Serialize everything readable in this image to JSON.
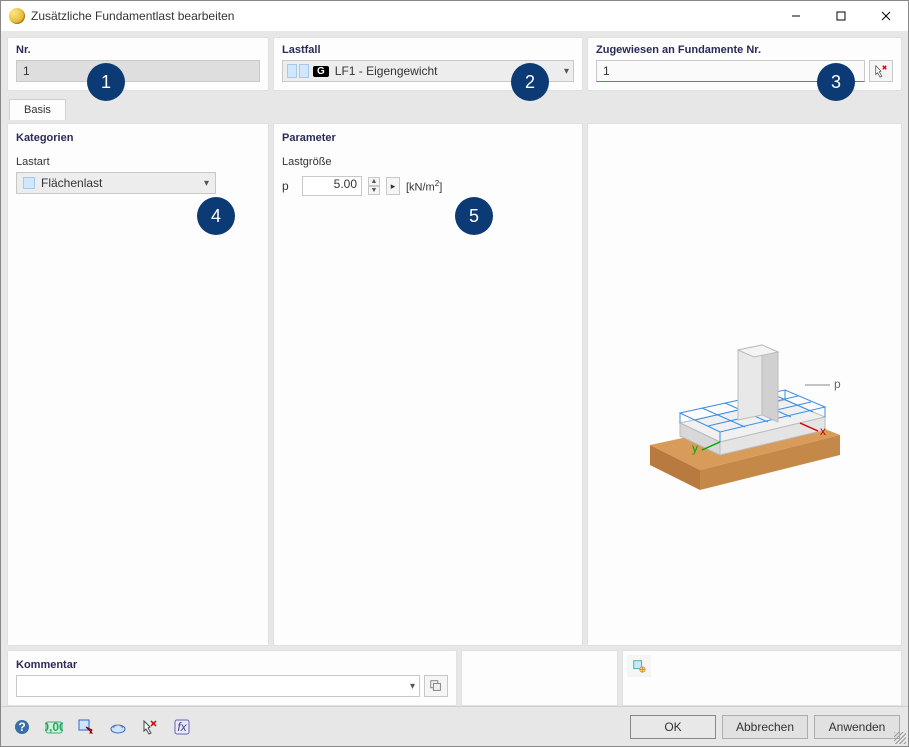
{
  "window": {
    "title": "Zusätzliche Fundamentlast bearbeiten"
  },
  "header": {
    "nr_label": "Nr.",
    "nr_value": "1",
    "lastfall_label": "Lastfall",
    "lastfall_badge": "G",
    "lastfall_value": "LF1 - Eigengewicht",
    "assigned_label": "Zugewiesen an Fundamente Nr.",
    "assigned_value": "1"
  },
  "tabs": {
    "basis": "Basis"
  },
  "categories": {
    "title": "Kategorien",
    "lastart_label": "Lastart",
    "lastart_value": "Flächenlast"
  },
  "parameters": {
    "title": "Parameter",
    "lastgroesse_label": "Lastgröße",
    "symbol": "p",
    "value": "5.00",
    "unit_html": "[kN/m²]"
  },
  "comment": {
    "title": "Kommentar",
    "value": ""
  },
  "preview": {
    "load_label": "p",
    "axis_x": "x",
    "axis_y": "y"
  },
  "buttons": {
    "ok": "OK",
    "cancel": "Abbrechen",
    "apply": "Anwenden"
  },
  "callouts": [
    "1",
    "2",
    "3",
    "4",
    "5"
  ]
}
